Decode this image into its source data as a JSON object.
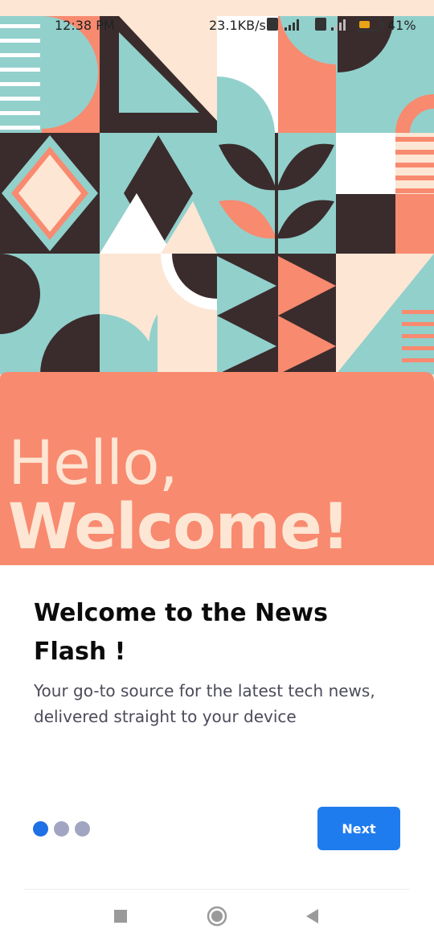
{
  "status_bar": {
    "time": "12:38 PM",
    "network_speed": "23.1KB/s",
    "network_type": "4G",
    "volte_label": "Vo LTE",
    "battery_percent": "41%",
    "icons": [
      "volte-icon",
      "signal-icon",
      "battery-icon"
    ]
  },
  "hero": {
    "greeting": "Hello,",
    "welcome": "Welcome!",
    "colors": {
      "coral": "#f88a6f",
      "teal": "#92d0cc",
      "cream": "#fde6d4",
      "dark": "#3a2c2c",
      "white": "#ffffff"
    }
  },
  "onboarding": {
    "title": "Welcome to the News Flash !",
    "subtitle": "Your go-to source for the latest tech news, delivered straight to your device",
    "page_indicator": {
      "total": 3,
      "current": 1
    },
    "next_label": "Next",
    "accent_color": "#1f7cee"
  },
  "nav_bar": {
    "buttons": [
      "recents-icon",
      "home-icon",
      "back-icon"
    ]
  }
}
